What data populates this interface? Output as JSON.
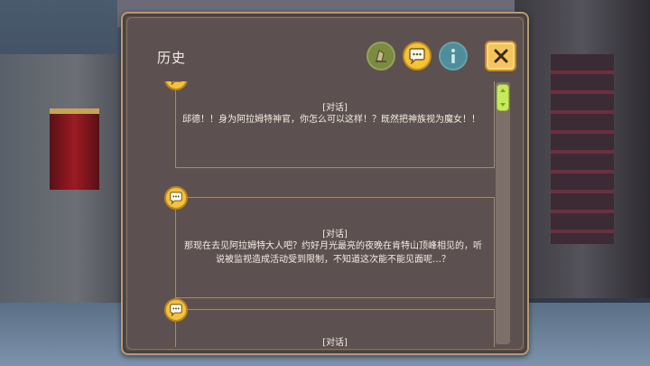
{
  "panel": {
    "title": "历史"
  },
  "header_buttons": [
    {
      "icon": "voice-icon",
      "color": "#7b8b42"
    },
    {
      "icon": "chat-bubble-icon",
      "color": "#f4c338"
    },
    {
      "icon": "info-icon",
      "color": "#4f8d9a"
    }
  ],
  "close_button": {
    "icon": "close-icon",
    "color": "#f3c55c"
  },
  "entries": [
    {
      "tag": "[对话]",
      "text": "邱德！！身为阿拉姆特神官，你怎么可以这样！？既然把神族视为魔女！！"
    },
    {
      "tag": "[对话]",
      "text": "那现在去见阿拉姆特大人吧？约好月光最亮的夜晚在肯特山顶峰相见的，听说被监视造成活动受到限制，不知道这次能不能见面呢…？"
    },
    {
      "tag": "[对话]",
      "text": ""
    }
  ],
  "scrollbar": {
    "position": 0.0
  }
}
